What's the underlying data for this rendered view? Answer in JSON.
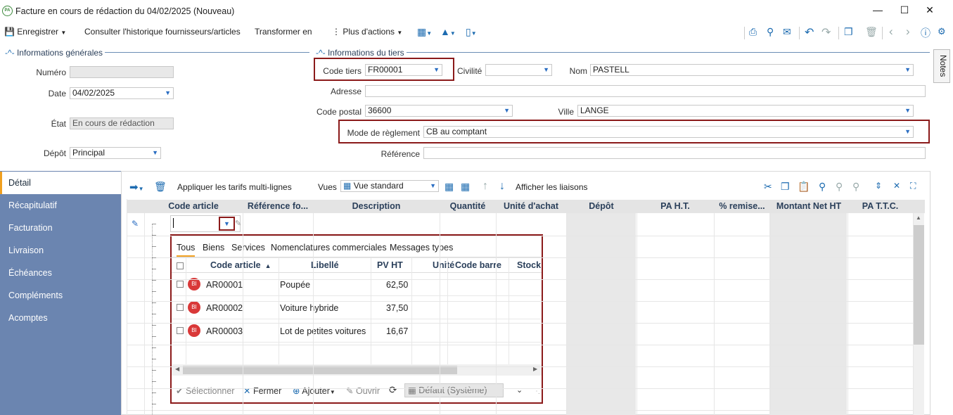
{
  "window": {
    "title": "Facture en cours de rédaction du 04/02/2025 (Nouveau)",
    "logo": "PA"
  },
  "toolbar": {
    "save": "Enregistrer",
    "history": "Consulter l'historique fournisseurs/articles",
    "transform": "Transformer en",
    "more": "Plus d'actions"
  },
  "general": {
    "section": "Informations générales",
    "numero_label": "Numéro",
    "numero_value": "",
    "date_label": "Date",
    "date_value": "04/02/2025",
    "etat_label": "État",
    "etat_value": "En cours de rédaction",
    "depot_label": "Dépôt",
    "depot_value": "Principal"
  },
  "tiers": {
    "section": "Informations du tiers",
    "code_label": "Code tiers",
    "code_value": "FR00001",
    "civilite_label": "Civilité",
    "civilite_value": "",
    "nom_label": "Nom",
    "nom_value": "PASTELL",
    "adresse_label": "Adresse",
    "adresse_value": "",
    "cp_label": "Code postal",
    "cp_value": "36600",
    "ville_label": "Ville",
    "ville_value": "LANGE",
    "mode_label": "Mode de règlement",
    "mode_value": "CB au comptant",
    "ref_label": "Référence",
    "ref_value": ""
  },
  "notes_label": "Notes",
  "side_tabs": [
    "Détail",
    "Récapitulatif",
    "Facturation",
    "Livraison",
    "Échéances",
    "Compléments",
    "Acomptes"
  ],
  "grid_toolbar": {
    "apply": "Appliquer les tarifs multi-lignes",
    "vues_label": "Vues",
    "vue_value": "Vue standard",
    "links": "Afficher les liaisons"
  },
  "grid_columns": [
    "Code article",
    "Référence fo...",
    "Description",
    "Quantité",
    "Unité d'achat",
    "Dépôt",
    "PA H.T.",
    "% remise...",
    "Montant Net HT",
    "PA T.T.C."
  ],
  "popup": {
    "tabs": [
      "Tous",
      "Biens",
      "Services",
      "Nomenclatures commerciales",
      "Messages types"
    ],
    "columns": [
      "Code article",
      "Libellé",
      "PV HT",
      "Unité",
      "Code barre",
      "Stock"
    ],
    "rows": [
      {
        "badge": "BI",
        "code": "AR00001",
        "label": "Poupée",
        "price": "62,50"
      },
      {
        "badge": "BI",
        "code": "AR00002",
        "label": "Voiture hybride",
        "price": "37,50"
      },
      {
        "badge": "BI",
        "code": "AR00003",
        "label": "Lot de petites voitures",
        "price": "16,67"
      }
    ],
    "footer": {
      "select": "Sélectionner",
      "close": "Fermer",
      "add": "Ajouter",
      "open": "Ouvrir",
      "view": "Défaut (Système)"
    }
  },
  "colors": {
    "accent": "#1c6bb0",
    "sidebar": "#6b85b0",
    "highlight": "#8b1a1a",
    "active_tab": "#f0a020"
  }
}
